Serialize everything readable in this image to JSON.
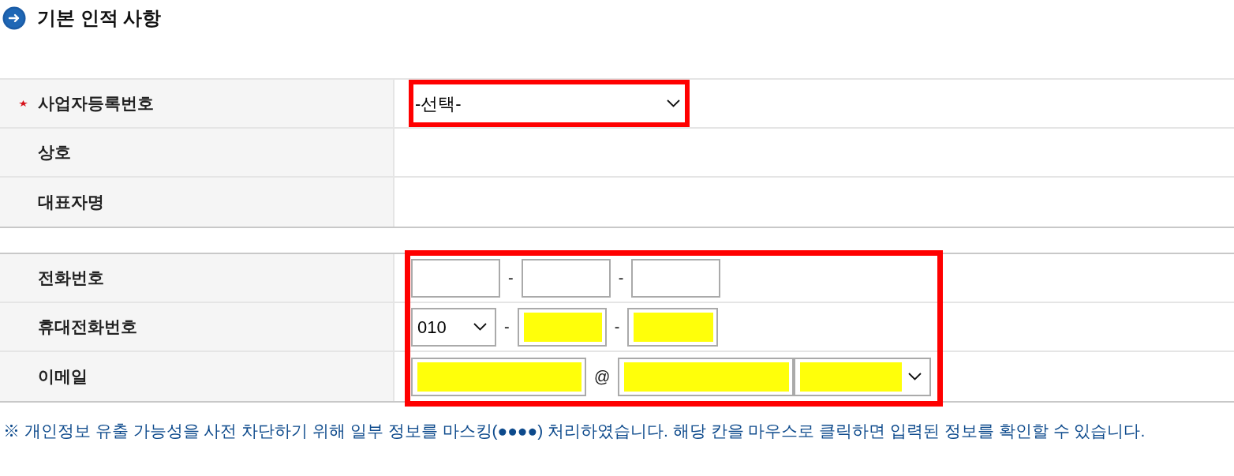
{
  "section": {
    "title": "기본 인적 사항"
  },
  "business_table": {
    "rows": [
      {
        "label": "사업자등록번호",
        "required": true,
        "fields": [
          {
            "kind": "select",
            "value": "-선택-",
            "masked": false,
            "highlighted": true
          }
        ]
      },
      {
        "label": "상호",
        "required": false
      },
      {
        "label": "대표자명",
        "required": false
      }
    ]
  },
  "contact_table": {
    "highlighted": true,
    "rows": [
      {
        "label": "전화번호",
        "required": false,
        "fields": [
          {
            "kind": "input",
            "masked": false
          },
          {
            "kind": "separator",
            "text": "-"
          },
          {
            "kind": "input",
            "masked": false
          },
          {
            "kind": "separator",
            "text": "-"
          },
          {
            "kind": "input",
            "masked": false
          }
        ]
      },
      {
        "label": "휴대전화번호",
        "required": false,
        "fields": [
          {
            "kind": "select",
            "value": "010",
            "masked": false
          },
          {
            "kind": "separator",
            "text": "-"
          },
          {
            "kind": "input",
            "masked": true
          },
          {
            "kind": "separator",
            "text": "-"
          },
          {
            "kind": "input",
            "masked": true
          }
        ]
      },
      {
        "label": "이메일",
        "required": false,
        "fields": [
          {
            "kind": "input",
            "masked": true
          },
          {
            "kind": "separator",
            "text": "@"
          },
          {
            "kind": "input",
            "masked": true
          },
          {
            "kind": "select",
            "masked": true
          }
        ]
      }
    ]
  },
  "note": "※ 개인정보 유출 가능성을 사전 차단하기 위해 일부 정보를 마스킹(●●●●) 처리하였습니다. 해당 칸을 마우스로 클릭하면 입력된 정보를 확인할 수 있습니다."
}
